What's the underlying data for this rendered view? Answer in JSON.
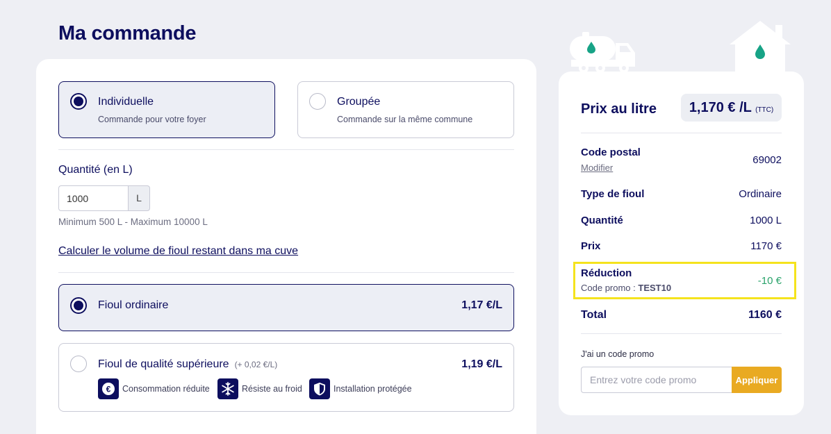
{
  "page": {
    "title": "Ma commande"
  },
  "order_type": {
    "options": [
      {
        "title": "Individuelle",
        "subtitle": "Commande pour votre foyer",
        "selected": true
      },
      {
        "title": "Groupée",
        "subtitle": "Commande sur la même commune",
        "selected": false
      }
    ]
  },
  "quantity": {
    "label": "Quantité (en L)",
    "value": "1000",
    "unit": "L",
    "hint": "Minimum 500 L - Maximum 10000 L",
    "calc_link": "Calculer le volume de fioul restant dans ma cuve"
  },
  "fuel": {
    "options": [
      {
        "name": "Fioul ordinaire",
        "extra": "",
        "price": "1,17 €/L",
        "selected": true
      },
      {
        "name": "Fioul de qualité supérieure",
        "extra": "(+ 0,02 €/L)",
        "price": "1,19 €/L",
        "selected": false
      }
    ],
    "features": [
      {
        "icon": "euro-icon",
        "label": "Consommation réduite"
      },
      {
        "icon": "snowflake-icon",
        "label": "Résiste au froid"
      },
      {
        "icon": "shield-icon",
        "label": "Installation protégée"
      }
    ]
  },
  "summary": {
    "price_title": "Prix au litre",
    "price_value": "1,170 € /L",
    "price_ttc": "(TTC)",
    "postal_code": {
      "label": "Code postal",
      "modify": "Modifier",
      "value": "69002"
    },
    "fuel_type": {
      "label": "Type de fioul",
      "value": "Ordinaire"
    },
    "quantity": {
      "label": "Quantité",
      "value": "1000 L"
    },
    "price": {
      "label": "Prix",
      "value": "1170 €"
    },
    "reduction": {
      "label": "Réduction",
      "promo_prefix": "Code promo :",
      "promo_code": "TEST10",
      "value": "-10 €"
    },
    "total": {
      "label": "Total",
      "value": "1160 €"
    },
    "promo": {
      "label": "J'ai un code promo",
      "placeholder": "Entrez votre code promo",
      "button": "Appliquer"
    }
  },
  "colors": {
    "primary": "#0d0e5e",
    "accent": "#e9aa22",
    "success": "#2aa36b",
    "highlight": "#f5e31d",
    "drop": "#17a386"
  }
}
